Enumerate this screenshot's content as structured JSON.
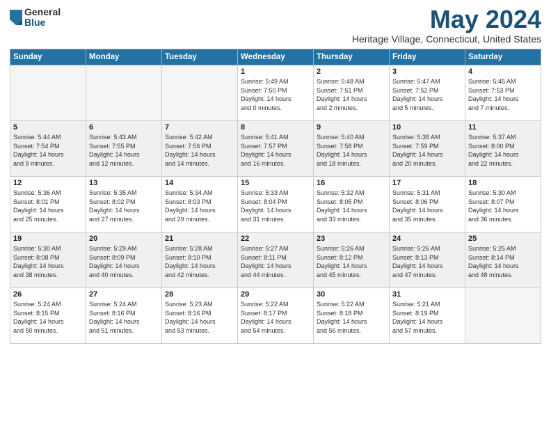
{
  "header": {
    "logo_general": "General",
    "logo_blue": "Blue",
    "month": "May 2024",
    "location": "Heritage Village, Connecticut, United States"
  },
  "weekdays": [
    "Sunday",
    "Monday",
    "Tuesday",
    "Wednesday",
    "Thursday",
    "Friday",
    "Saturday"
  ],
  "weeks": [
    [
      {
        "day": "",
        "empty": true
      },
      {
        "day": "",
        "empty": true
      },
      {
        "day": "",
        "empty": true
      },
      {
        "day": "1",
        "line1": "Sunrise: 5:49 AM",
        "line2": "Sunset: 7:50 PM",
        "line3": "Daylight: 14 hours",
        "line4": "and 0 minutes."
      },
      {
        "day": "2",
        "line1": "Sunrise: 5:48 AM",
        "line2": "Sunset: 7:51 PM",
        "line3": "Daylight: 14 hours",
        "line4": "and 2 minutes."
      },
      {
        "day": "3",
        "line1": "Sunrise: 5:47 AM",
        "line2": "Sunset: 7:52 PM",
        "line3": "Daylight: 14 hours",
        "line4": "and 5 minutes."
      },
      {
        "day": "4",
        "line1": "Sunrise: 5:45 AM",
        "line2": "Sunset: 7:53 PM",
        "line3": "Daylight: 14 hours",
        "line4": "and 7 minutes."
      }
    ],
    [
      {
        "day": "5",
        "line1": "Sunrise: 5:44 AM",
        "line2": "Sunset: 7:54 PM",
        "line3": "Daylight: 14 hours",
        "line4": "and 9 minutes."
      },
      {
        "day": "6",
        "line1": "Sunrise: 5:43 AM",
        "line2": "Sunset: 7:55 PM",
        "line3": "Daylight: 14 hours",
        "line4": "and 12 minutes."
      },
      {
        "day": "7",
        "line1": "Sunrise: 5:42 AM",
        "line2": "Sunset: 7:56 PM",
        "line3": "Daylight: 14 hours",
        "line4": "and 14 minutes."
      },
      {
        "day": "8",
        "line1": "Sunrise: 5:41 AM",
        "line2": "Sunset: 7:57 PM",
        "line3": "Daylight: 14 hours",
        "line4": "and 16 minutes."
      },
      {
        "day": "9",
        "line1": "Sunrise: 5:40 AM",
        "line2": "Sunset: 7:58 PM",
        "line3": "Daylight: 14 hours",
        "line4": "and 18 minutes."
      },
      {
        "day": "10",
        "line1": "Sunrise: 5:38 AM",
        "line2": "Sunset: 7:59 PM",
        "line3": "Daylight: 14 hours",
        "line4": "and 20 minutes."
      },
      {
        "day": "11",
        "line1": "Sunrise: 5:37 AM",
        "line2": "Sunset: 8:00 PM",
        "line3": "Daylight: 14 hours",
        "line4": "and 22 minutes."
      }
    ],
    [
      {
        "day": "12",
        "line1": "Sunrise: 5:36 AM",
        "line2": "Sunset: 8:01 PM",
        "line3": "Daylight: 14 hours",
        "line4": "and 25 minutes."
      },
      {
        "day": "13",
        "line1": "Sunrise: 5:35 AM",
        "line2": "Sunset: 8:02 PM",
        "line3": "Daylight: 14 hours",
        "line4": "and 27 minutes."
      },
      {
        "day": "14",
        "line1": "Sunrise: 5:34 AM",
        "line2": "Sunset: 8:03 PM",
        "line3": "Daylight: 14 hours",
        "line4": "and 29 minutes."
      },
      {
        "day": "15",
        "line1": "Sunrise: 5:33 AM",
        "line2": "Sunset: 8:04 PM",
        "line3": "Daylight: 14 hours",
        "line4": "and 31 minutes."
      },
      {
        "day": "16",
        "line1": "Sunrise: 5:32 AM",
        "line2": "Sunset: 8:05 PM",
        "line3": "Daylight: 14 hours",
        "line4": "and 33 minutes."
      },
      {
        "day": "17",
        "line1": "Sunrise: 5:31 AM",
        "line2": "Sunset: 8:06 PM",
        "line3": "Daylight: 14 hours",
        "line4": "and 35 minutes."
      },
      {
        "day": "18",
        "line1": "Sunrise: 5:30 AM",
        "line2": "Sunset: 8:07 PM",
        "line3": "Daylight: 14 hours",
        "line4": "and 36 minutes."
      }
    ],
    [
      {
        "day": "19",
        "line1": "Sunrise: 5:30 AM",
        "line2": "Sunset: 8:08 PM",
        "line3": "Daylight: 14 hours",
        "line4": "and 38 minutes."
      },
      {
        "day": "20",
        "line1": "Sunrise: 5:29 AM",
        "line2": "Sunset: 8:09 PM",
        "line3": "Daylight: 14 hours",
        "line4": "and 40 minutes."
      },
      {
        "day": "21",
        "line1": "Sunrise: 5:28 AM",
        "line2": "Sunset: 8:10 PM",
        "line3": "Daylight: 14 hours",
        "line4": "and 42 minutes."
      },
      {
        "day": "22",
        "line1": "Sunrise: 5:27 AM",
        "line2": "Sunset: 8:11 PM",
        "line3": "Daylight: 14 hours",
        "line4": "and 44 minutes."
      },
      {
        "day": "23",
        "line1": "Sunrise: 5:26 AM",
        "line2": "Sunset: 8:12 PM",
        "line3": "Daylight: 14 hours",
        "line4": "and 45 minutes."
      },
      {
        "day": "24",
        "line1": "Sunrise: 5:26 AM",
        "line2": "Sunset: 8:13 PM",
        "line3": "Daylight: 14 hours",
        "line4": "and 47 minutes."
      },
      {
        "day": "25",
        "line1": "Sunrise: 5:25 AM",
        "line2": "Sunset: 8:14 PM",
        "line3": "Daylight: 14 hours",
        "line4": "and 48 minutes."
      }
    ],
    [
      {
        "day": "26",
        "line1": "Sunrise: 5:24 AM",
        "line2": "Sunset: 8:15 PM",
        "line3": "Daylight: 14 hours",
        "line4": "and 50 minutes."
      },
      {
        "day": "27",
        "line1": "Sunrise: 5:24 AM",
        "line2": "Sunset: 8:16 PM",
        "line3": "Daylight: 14 hours",
        "line4": "and 51 minutes."
      },
      {
        "day": "28",
        "line1": "Sunrise: 5:23 AM",
        "line2": "Sunset: 8:16 PM",
        "line3": "Daylight: 14 hours",
        "line4": "and 53 minutes."
      },
      {
        "day": "29",
        "line1": "Sunrise: 5:22 AM",
        "line2": "Sunset: 8:17 PM",
        "line3": "Daylight: 14 hours",
        "line4": "and 54 minutes."
      },
      {
        "day": "30",
        "line1": "Sunrise: 5:22 AM",
        "line2": "Sunset: 8:18 PM",
        "line3": "Daylight: 14 hours",
        "line4": "and 56 minutes."
      },
      {
        "day": "31",
        "line1": "Sunrise: 5:21 AM",
        "line2": "Sunset: 8:19 PM",
        "line3": "Daylight: 14 hours",
        "line4": "and 57 minutes."
      },
      {
        "day": "",
        "empty": true
      }
    ]
  ]
}
